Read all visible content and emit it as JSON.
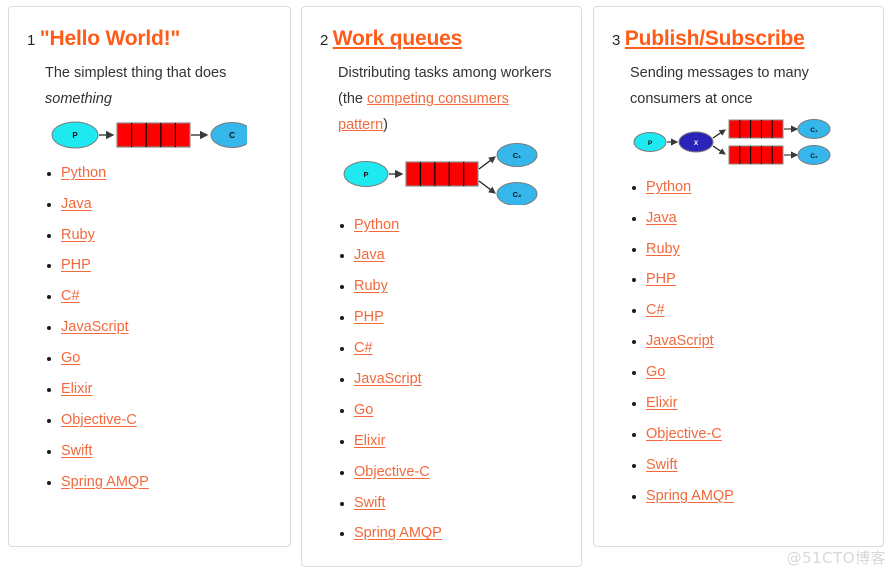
{
  "colors": {
    "heading_orange": "#FF5C1A",
    "link_orange": "#F2693C",
    "body_text": "#333333",
    "card_border": "#dcdcdc",
    "queue_red": "#FF0000",
    "producer_cyan": "#1EE8F0",
    "consumer_blue": "#35B7EC",
    "exchange_navy": "#2A24B8",
    "watermark": "#d8d8d8"
  },
  "watermark": "@51CTO博客",
  "cards": [
    {
      "number": "1",
      "title": "\"Hello World!\"",
      "title_linked": false,
      "description_parts": [
        {
          "text": "The simplest thing that does ",
          "style": "plain"
        },
        {
          "text": "something",
          "style": "italic"
        }
      ],
      "diagram": {
        "name": "hello-world-diagram",
        "producer": "P",
        "queues": [
          "queue"
        ],
        "consumers": [
          "C"
        ],
        "exchange": null
      },
      "languages": [
        "Python",
        "Java",
        "Ruby",
        "PHP",
        "C#",
        "JavaScript",
        "Go",
        "Elixir",
        "Objective-C",
        "Swift",
        "Spring AMQP"
      ]
    },
    {
      "number": "2",
      "title": "Work queues",
      "title_linked": true,
      "description_parts": [
        {
          "text": "Distributing tasks among workers (the ",
          "style": "plain"
        },
        {
          "text": "competing consumers pattern",
          "style": "link"
        },
        {
          "text": ")",
          "style": "plain"
        }
      ],
      "diagram": {
        "name": "work-queues-diagram",
        "producer": "P",
        "queues": [
          "queue"
        ],
        "consumers": [
          "C₁",
          "C₂"
        ],
        "exchange": null
      },
      "languages": [
        "Python",
        "Java",
        "Ruby",
        "PHP",
        "C#",
        "JavaScript",
        "Go",
        "Elixir",
        "Objective-C",
        "Swift",
        "Spring AMQP"
      ]
    },
    {
      "number": "3",
      "title": "Publish/Subscribe",
      "title_linked": true,
      "description_parts": [
        {
          "text": "Sending messages to many consumers at once",
          "style": "plain"
        }
      ],
      "diagram": {
        "name": "publish-subscribe-diagram",
        "producer": "P",
        "queues": [
          "queue1",
          "queue2"
        ],
        "consumers": [
          "C₁",
          "C₂"
        ],
        "exchange": "X"
      },
      "languages": [
        "Python",
        "Java",
        "Ruby",
        "PHP",
        "C#",
        "JavaScript",
        "Go",
        "Elixir",
        "Objective-C",
        "Swift",
        "Spring AMQP"
      ]
    }
  ]
}
